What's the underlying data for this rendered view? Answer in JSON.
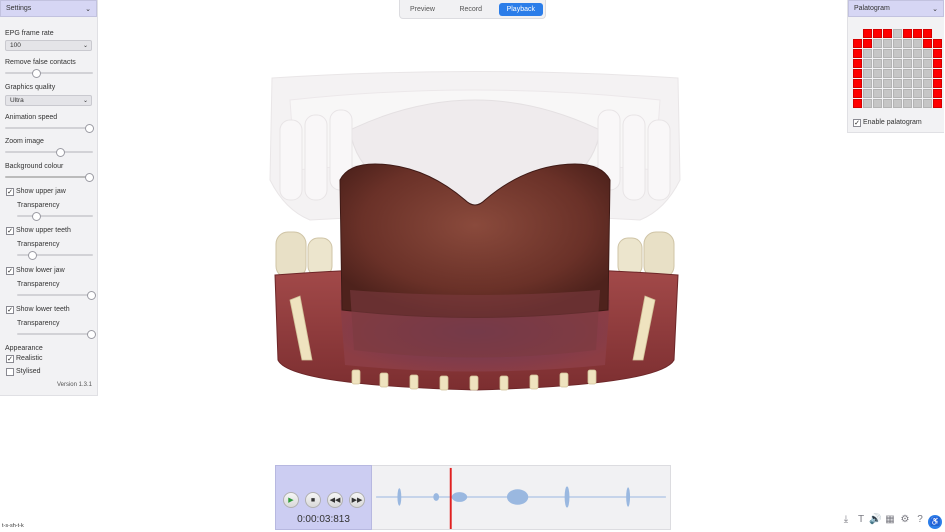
{
  "tabs": [
    {
      "label": "Preview",
      "active": false
    },
    {
      "label": "Record",
      "active": false
    },
    {
      "label": "Playback",
      "active": true
    }
  ],
  "settings": {
    "title": "Settings",
    "epg_frame_rate": {
      "label": "EPG frame rate",
      "value": "100"
    },
    "remove_false_contacts": {
      "label": "Remove false contacts",
      "value": 0.35
    },
    "graphics_quality": {
      "label": "Graphics quality",
      "value": "Ultra"
    },
    "animation_speed": {
      "label": "Animation speed",
      "value": 0.95
    },
    "zoom_image": {
      "label": "Zoom image",
      "value": 0.62
    },
    "background_colour": {
      "label": "Background colour",
      "value": 0.95
    },
    "show_upper_jaw": {
      "label": "Show upper jaw",
      "checked": true
    },
    "upper_jaw_transparency": {
      "label": "Transparency",
      "value": 0.25
    },
    "show_upper_teeth": {
      "label": "Show upper teeth",
      "checked": true
    },
    "upper_teeth_transparency": {
      "label": "Transparency",
      "value": 0.2
    },
    "show_lower_jaw": {
      "label": "Show lower jaw",
      "checked": true
    },
    "lower_jaw_transparency": {
      "label": "Transparency",
      "value": 0.98
    },
    "show_lower_teeth": {
      "label": "Show lower teeth",
      "checked": true
    },
    "lower_teeth_transparency": {
      "label": "Transparency",
      "value": 0.98
    },
    "appearance": {
      "label": "Appearance"
    },
    "realistic": {
      "label": "Realistic",
      "checked": true
    },
    "stylised": {
      "label": "Stylised",
      "checked": false
    },
    "version": "Version 1.3.1"
  },
  "palatogram": {
    "title": "Palatogram",
    "enable": {
      "label": "Enable palatogram",
      "checked": true
    },
    "active_color": "#ff0000",
    "inactive_color": "#c6c6c6",
    "rows": [
      [
        null,
        1,
        1,
        1,
        0,
        1,
        1,
        1,
        null
      ],
      [
        1,
        1,
        0,
        0,
        0,
        0,
        0,
        1,
        1
      ],
      [
        1,
        0,
        0,
        0,
        0,
        0,
        0,
        0,
        1
      ],
      [
        1,
        0,
        0,
        0,
        0,
        0,
        0,
        0,
        1
      ],
      [
        1,
        0,
        0,
        0,
        0,
        0,
        0,
        0,
        1
      ],
      [
        1,
        0,
        0,
        0,
        0,
        0,
        0,
        0,
        1
      ],
      [
        1,
        0,
        0,
        0,
        0,
        0,
        0,
        0,
        1
      ],
      [
        1,
        0,
        0,
        0,
        0,
        0,
        0,
        0,
        1
      ]
    ]
  },
  "playback": {
    "time": "0:00:03:813",
    "phonetic": "t-s-sh-t-k",
    "playhead_color": "#e02020",
    "wave_color": "#9ab8e0"
  },
  "toolbar": {
    "icons": [
      "export-icon",
      "text-icon",
      "volume-icon",
      "grid-icon",
      "settings-icon",
      "help-icon",
      "accessibility-icon"
    ]
  }
}
